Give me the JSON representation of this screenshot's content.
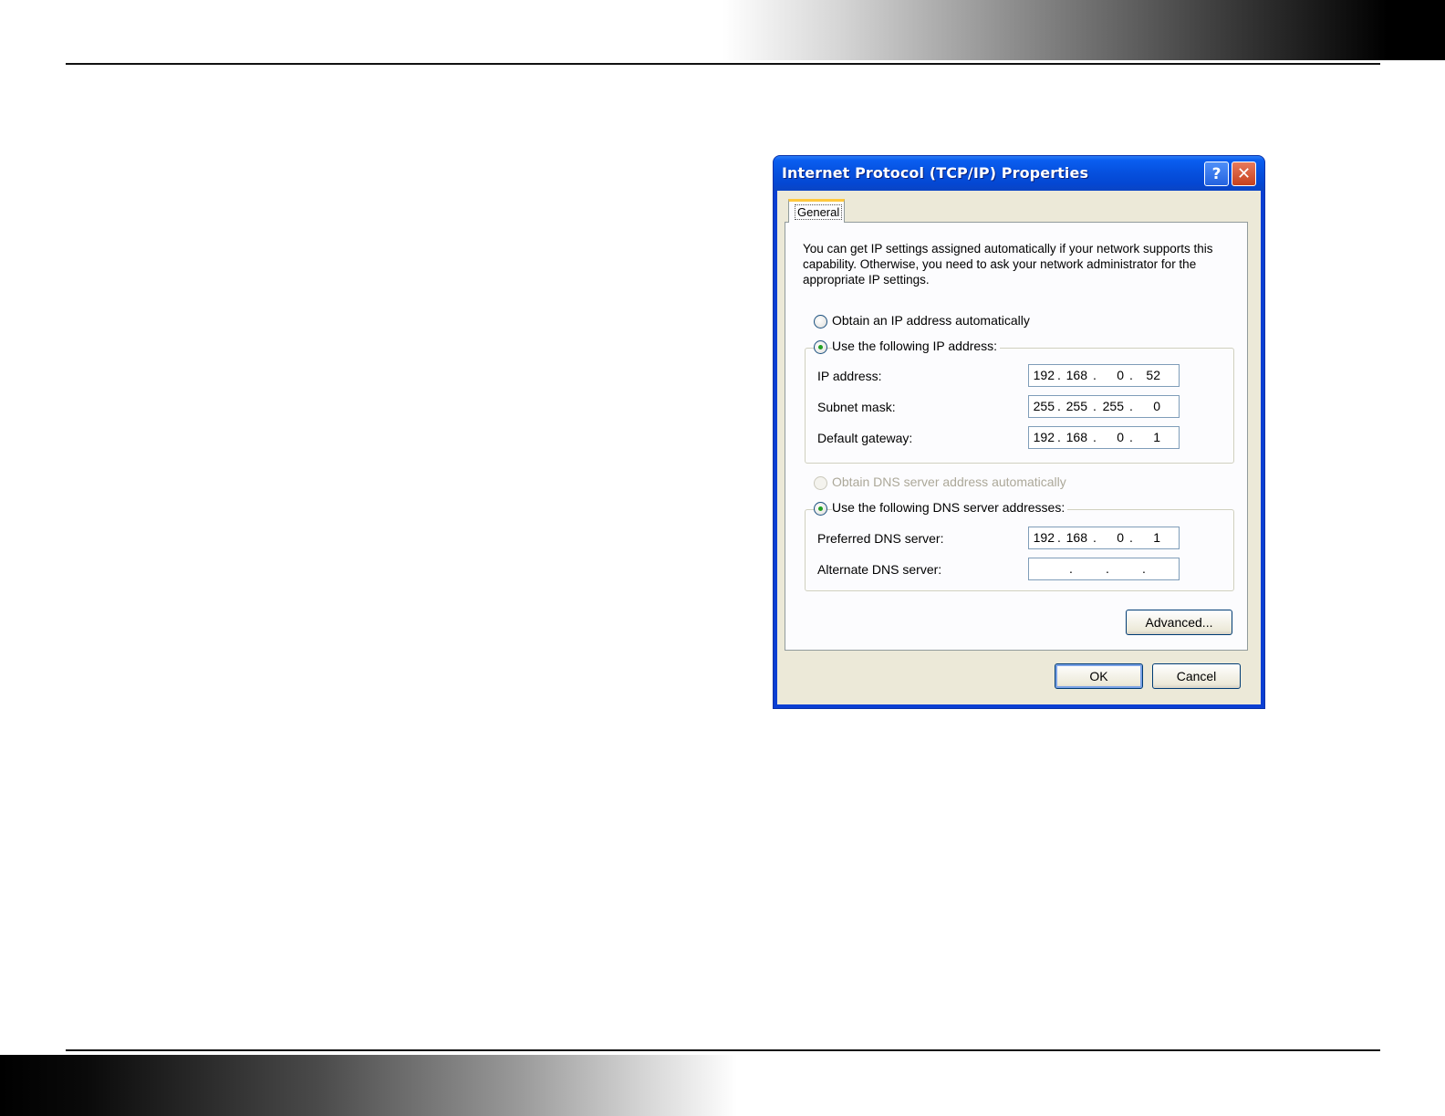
{
  "dialog": {
    "title": "Internet Protocol (TCP/IP) Properties",
    "help_glyph": "?",
    "close_glyph": "✕",
    "tab_label": "General",
    "description": "You can get IP settings assigned automatically if your network supports this capability. Otherwise, you need to ask your network administrator for the appropriate IP settings.",
    "ip_options": {
      "auto_label": "Obtain an IP address automatically",
      "manual_label": "Use the following IP address:",
      "selected": "manual"
    },
    "ip_fields": [
      {
        "label": "IP address:",
        "octets": [
          "192",
          "168",
          "0",
          "52"
        ]
      },
      {
        "label": "Subnet mask:",
        "octets": [
          "255",
          "255",
          "255",
          "0"
        ]
      },
      {
        "label": "Default gateway:",
        "octets": [
          "192",
          "168",
          "0",
          "1"
        ]
      }
    ],
    "dns_options": {
      "auto_label": "Obtain DNS server address automatically",
      "manual_label": "Use the following DNS server addresses:",
      "selected": "manual",
      "auto_disabled": true
    },
    "dns_fields": [
      {
        "label": "Preferred DNS server:",
        "octets": [
          "192",
          "168",
          "0",
          "1"
        ]
      },
      {
        "label": "Alternate DNS server:",
        "octets": [
          "",
          "",
          "",
          ""
        ]
      }
    ],
    "advanced_label": "Advanced...",
    "ok_label": "OK",
    "cancel_label": "Cancel",
    "colors": {
      "titlebar": "#0651e0",
      "client_bg": "#ece9d8",
      "tab_highlight": "#ffc83c",
      "radio_dot": "#21a121"
    }
  },
  "icons": {
    "help": "question-mark-icon",
    "close": "close-icon"
  }
}
